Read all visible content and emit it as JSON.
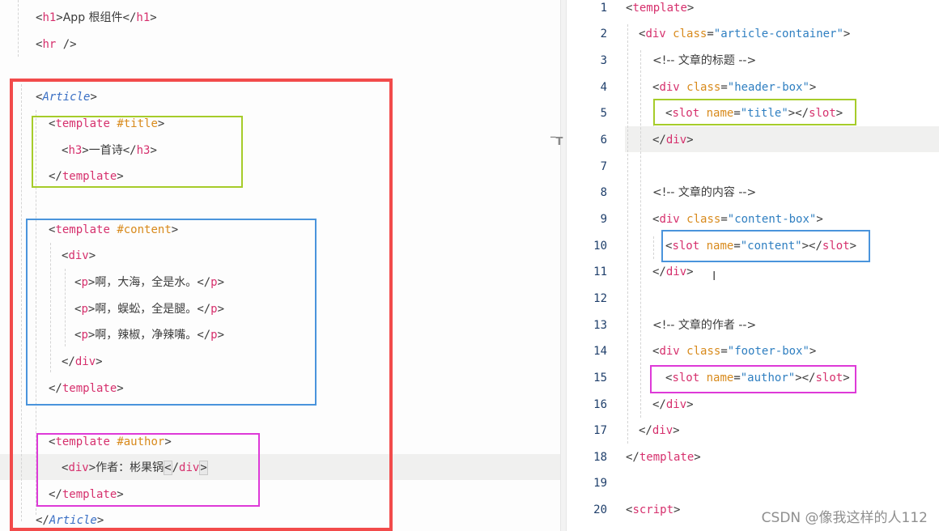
{
  "colors": {
    "red_box": "#f24b4b",
    "green_box": "#a6cc2a",
    "blue_box": "#4a94dc",
    "magenta_box": "#de3ad8",
    "tag": "#d6306d",
    "attribute": "#d88a1c",
    "string": "#2f7fc1",
    "comment": "#9a9a9a",
    "line_number": "#1f3f6b"
  },
  "left_editor": {
    "h1_tag_open": "h1",
    "h1_text": "App 根组件",
    "h1_tag_close": "h1",
    "hr_tag": "hr",
    "article_open": "Article",
    "title_template_tag": "template",
    "title_template_attr": "#title",
    "h3_tag_open": "h3",
    "h3_text": "一首诗",
    "h3_tag_close": "h3",
    "title_template_close": "template",
    "content_template_tag": "template",
    "content_template_attr": "#content",
    "div_open": "div",
    "poem": [
      {
        "tag": "p",
        "text": "啊，大海，全是水。"
      },
      {
        "tag": "p",
        "text": "啊，蜈蚣，全是腿。"
      },
      {
        "tag": "p",
        "text": "啊，辣椒，净辣嘴。"
      }
    ],
    "div_close": "div",
    "content_template_close": "template",
    "author_template_tag": "template",
    "author_template_attr": "#author",
    "author_div_tag": "div",
    "author_text": "作者：彬果锅",
    "author_div_close": "div",
    "author_template_close": "template",
    "article_close": "Article"
  },
  "right_editor": {
    "line_numbers": [
      "1",
      "2",
      "3",
      "4",
      "5",
      "6",
      "7",
      "8",
      "9",
      "10",
      "11",
      "12",
      "13",
      "14",
      "15",
      "16",
      "17",
      "18",
      "19",
      "20"
    ],
    "template_tag": "template",
    "div_tag": "div",
    "class_attr": "class",
    "container_class": "\"article-container\"",
    "comment_title": "<!-- 文章的标题 -->",
    "header_class": "\"header-box\"",
    "slot_tag": "slot",
    "name_attr": "name",
    "slot_title": "\"title\"",
    "comment_content": "<!-- 文章的内容 -->",
    "content_class": "\"content-box\"",
    "slot_content": "\"content\"",
    "comment_author": "<!-- 文章的作者 -->",
    "footer_class": "\"footer-box\"",
    "slot_author": "\"author\"",
    "script_tag": "script"
  },
  "watermark": "CSDN @像我这样的人112"
}
